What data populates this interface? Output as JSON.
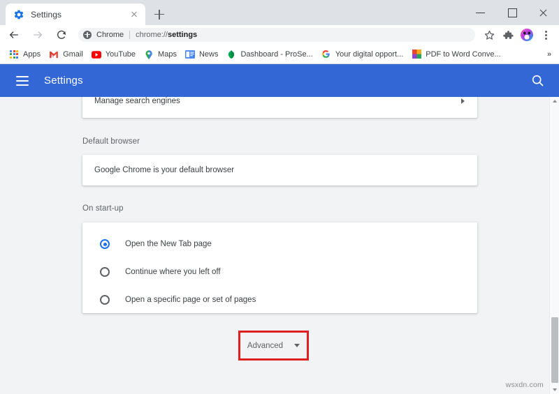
{
  "window": {
    "minimize_label": "Minimize",
    "maximize_label": "Maximize",
    "close_label": "Close"
  },
  "tab": {
    "title": "Settings",
    "favicon": "gear-icon",
    "close_label": "Close tab",
    "new_tab_label": "New Tab"
  },
  "toolbar": {
    "back_label": "Back",
    "forward_label": "Forward",
    "reload_label": "Reload",
    "omnibox": {
      "chip_label": "Chrome",
      "url_prefix": "chrome://",
      "url_bold": "settings",
      "full_url": "chrome://settings"
    },
    "bookmark_star_label": "Bookmark this tab",
    "extensions_label": "Extensions",
    "profile_label": "Profile",
    "menu_label": "Customize and control Google Chrome"
  },
  "bookmarks": {
    "items": [
      {
        "label": "Apps",
        "icon": "apps-grid-icon"
      },
      {
        "label": "Gmail",
        "icon": "gmail-icon"
      },
      {
        "label": "YouTube",
        "icon": "youtube-icon"
      },
      {
        "label": "Maps",
        "icon": "maps-pin-icon"
      },
      {
        "label": "News",
        "icon": "news-icon"
      },
      {
        "label": "Dashboard - ProSe...",
        "icon": "dashboard-icon"
      },
      {
        "label": "Your digital opport...",
        "icon": "google-g-icon"
      },
      {
        "label": "PDF to Word Conve...",
        "icon": "pdf-to-word-icon"
      }
    ],
    "overflow_label": "»"
  },
  "settings_header": {
    "menu_label": "Main menu",
    "title": "Settings",
    "search_label": "Search settings",
    "bg_color": "#3367d6"
  },
  "main": {
    "search_engines": {
      "row_label": "Manage search engines",
      "arrow": "chevron-right-icon"
    },
    "default_browser": {
      "section_title": "Default browser",
      "status_text": "Google Chrome is your default browser"
    },
    "on_startup": {
      "section_title": "On start-up",
      "options": [
        {
          "label": "Open the New Tab page",
          "selected": true
        },
        {
          "label": "Continue where you left off",
          "selected": false
        },
        {
          "label": "Open a specific page or set of pages",
          "selected": false
        }
      ]
    },
    "advanced": {
      "label": "Advanced",
      "caret": "chevron-down-icon",
      "highlight_color": "#e02020"
    }
  },
  "scrollbar": {
    "up_label": "Scroll up",
    "down_label": "Scroll down",
    "thumb_label": "Vertical scroll thumb"
  },
  "watermark": {
    "text": "wsxdn.com"
  },
  "colors": {
    "accent_blue": "#1a73e8",
    "header_blue": "#3367d6",
    "page_bg": "#f1f3f4",
    "card_bg": "#ffffff",
    "highlight_red": "#e02020"
  }
}
